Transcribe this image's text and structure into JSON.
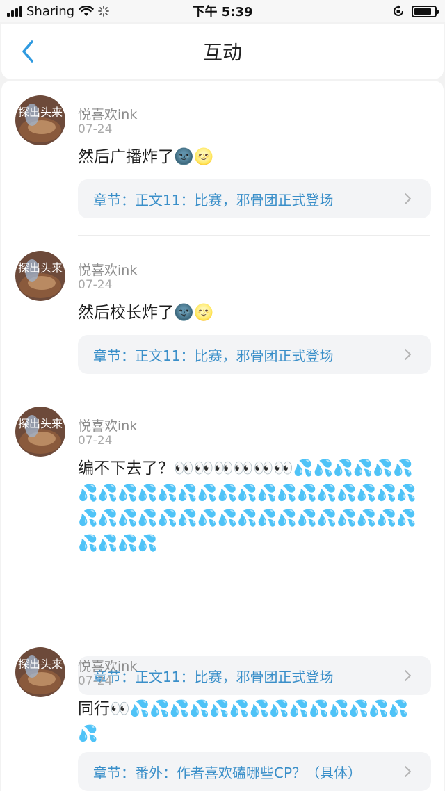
{
  "status_bar": {
    "carrier": "Sharing",
    "time": "下午 5:39",
    "battery_level": 0.85
  },
  "nav": {
    "title": "互动",
    "back_icon": "chevron-left-icon"
  },
  "comments": [
    {
      "username": "悦喜欢ink",
      "date": "07-24",
      "content": "然后广播炸了🌚🌝",
      "chapter": "章节：正文11：比赛，邪骨团正式登场"
    },
    {
      "username": "悦喜欢ink",
      "date": "07-24",
      "content": "然后校长炸了🌚🌝",
      "chapter": "章节：正文11：比赛，邪骨团正式登场"
    },
    {
      "username": "悦喜欢ink",
      "date": "07-24",
      "content": "编不下去了？👀👀👀👀👀👀💦💦💦💦💦💦💦💦💦💦💦💦💦💦💦💦💦💦💦💦💦💦💦💦💦💦💦💦💦💦💦💦💦💦💦💦💦💦💦💦💦💦💦💦",
      "chapter": "章节：正文11：比赛，邪骨团正式登场"
    },
    {
      "username": "悦喜欢ink",
      "date": "07-24",
      "content": "同行👀💦💦💦💦💦💦💦💦💦💦💦💦💦💦💦",
      "chapter": "章节：番外：作者喜欢磕哪些CP？（具体）"
    }
  ],
  "avatar_overlay_text": "探出头来",
  "colors": {
    "accent": "#3a8fc9",
    "back_icon": "#2f9ae0",
    "muted_text": "#8d8d8d"
  }
}
